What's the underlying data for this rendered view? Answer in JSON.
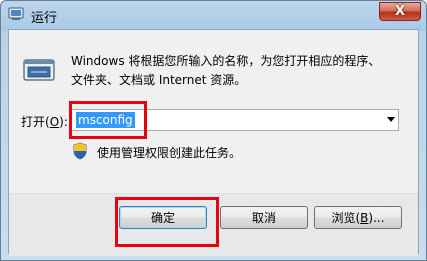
{
  "window": {
    "title": "运行",
    "close_symbol": "X"
  },
  "description_lines": [
    "Windows 将根据您所输入的名称，为您打开相应的程序、",
    "文件夹、文档或 Internet 资源。"
  ],
  "open_field": {
    "label_prefix": "打开(",
    "label_accel": "O",
    "label_suffix": "):",
    "value": "msconfig"
  },
  "admin_notice": "使用管理权限创建此任务。",
  "buttons": {
    "ok": "确定",
    "cancel": "取消",
    "browse_prefix": "浏览(",
    "browse_accel": "B",
    "browse_suffix": ")..."
  },
  "colors": {
    "highlight": "#e60012",
    "selection": "#3399ff",
    "close_button": "#c5442c"
  }
}
